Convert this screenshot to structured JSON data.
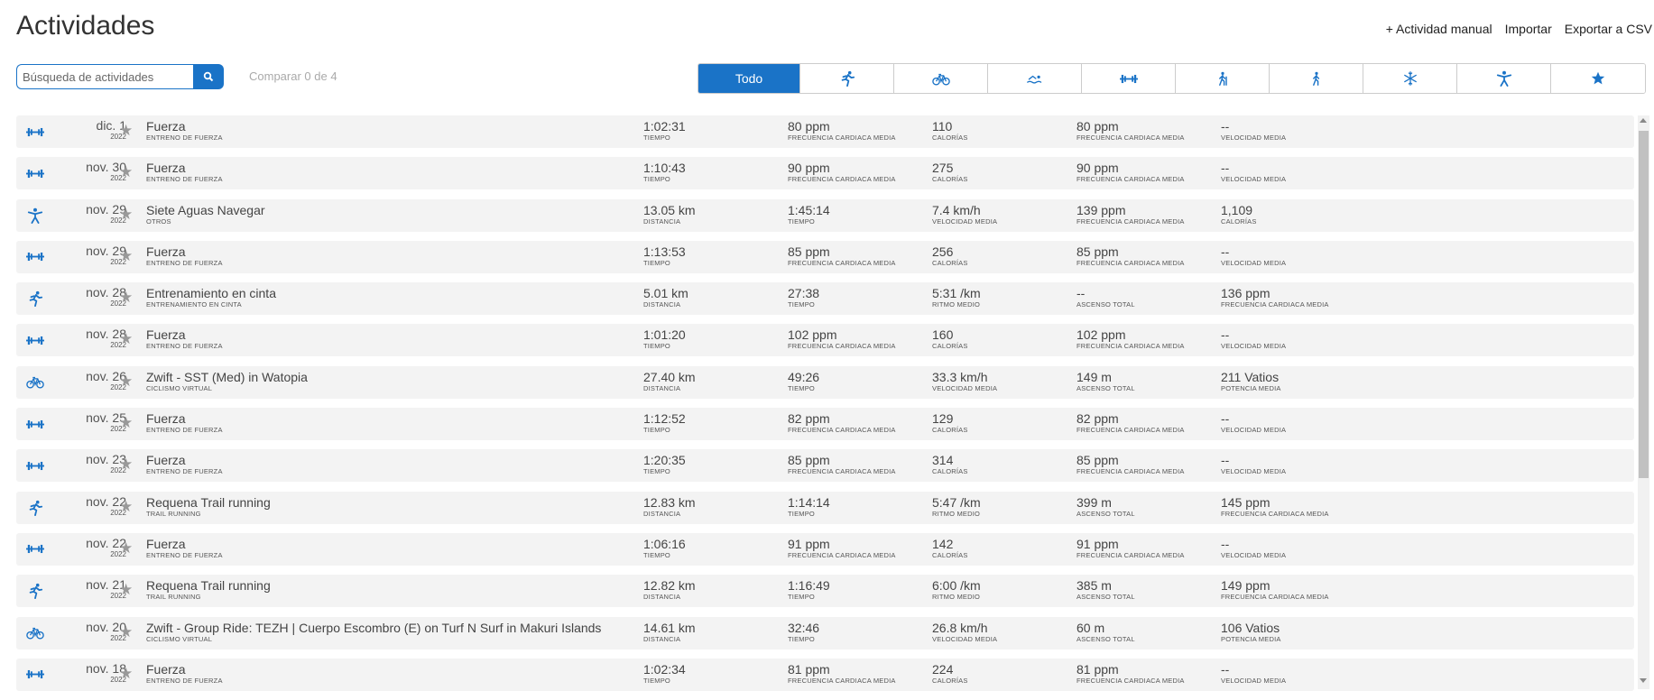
{
  "header": {
    "title": "Actividades",
    "links": [
      "+ Actividad manual",
      "Importar",
      "Exportar a CSV"
    ]
  },
  "search": {
    "placeholder": "Búsqueda de actividades"
  },
  "compare": "Comparar 0 de 4",
  "filters": [
    {
      "label": "Todo",
      "active": true
    },
    {
      "icon": "running"
    },
    {
      "icon": "cycling"
    },
    {
      "icon": "swimming"
    },
    {
      "icon": "strength"
    },
    {
      "icon": "hiking"
    },
    {
      "icon": "walking"
    },
    {
      "icon": "snowflake"
    },
    {
      "icon": "other"
    },
    {
      "icon": "star"
    }
  ],
  "activities": [
    {
      "icon": "strength",
      "date": "dic. 1",
      "year": "2022",
      "name": "Fuerza",
      "type": "ENTRENO DE FUERZA",
      "stats": [
        {
          "v": "1:02:31",
          "l": "TIEMPO"
        },
        {
          "v": "80 ppm",
          "l": "FRECUENCIA CARDIACA MEDIA"
        },
        {
          "v": "110",
          "l": "CALORÍAS"
        },
        {
          "v": "80 ppm",
          "l": "FRECUENCIA CARDIACA MEDIA"
        },
        {
          "v": "--",
          "l": "VELOCIDAD MEDIA"
        }
      ]
    },
    {
      "icon": "strength",
      "date": "nov. 30",
      "year": "2022",
      "name": "Fuerza",
      "type": "ENTRENO DE FUERZA",
      "stats": [
        {
          "v": "1:10:43",
          "l": "TIEMPO"
        },
        {
          "v": "90 ppm",
          "l": "FRECUENCIA CARDIACA MEDIA"
        },
        {
          "v": "275",
          "l": "CALORÍAS"
        },
        {
          "v": "90 ppm",
          "l": "FRECUENCIA CARDIACA MEDIA"
        },
        {
          "v": "--",
          "l": "VELOCIDAD MEDIA"
        }
      ]
    },
    {
      "icon": "other",
      "date": "nov. 29",
      "year": "2022",
      "name": "Siete Aguas Navegar",
      "type": "OTROS",
      "stats": [
        {
          "v": "13.05 km",
          "l": "DISTANCIA"
        },
        {
          "v": "1:45:14",
          "l": "TIEMPO"
        },
        {
          "v": "7.4 km/h",
          "l": "VELOCIDAD MEDIA"
        },
        {
          "v": "139 ppm",
          "l": "FRECUENCIA CARDIACA MEDIA"
        },
        {
          "v": "1,109",
          "l": "CALORÍAS"
        }
      ]
    },
    {
      "icon": "strength",
      "date": "nov. 29",
      "year": "2022",
      "name": "Fuerza",
      "type": "ENTRENO DE FUERZA",
      "stats": [
        {
          "v": "1:13:53",
          "l": "TIEMPO"
        },
        {
          "v": "85 ppm",
          "l": "FRECUENCIA CARDIACA MEDIA"
        },
        {
          "v": "256",
          "l": "CALORÍAS"
        },
        {
          "v": "85 ppm",
          "l": "FRECUENCIA CARDIACA MEDIA"
        },
        {
          "v": "--",
          "l": "VELOCIDAD MEDIA"
        }
      ]
    },
    {
      "icon": "running",
      "date": "nov. 28",
      "year": "2022",
      "name": "Entrenamiento en cinta",
      "type": "ENTRENAMIENTO EN CINTA",
      "stats": [
        {
          "v": "5.01 km",
          "l": "DISTANCIA"
        },
        {
          "v": "27:38",
          "l": "TIEMPO"
        },
        {
          "v": "5:31 /km",
          "l": "RITMO MEDIO"
        },
        {
          "v": "--",
          "l": "ASCENSO TOTAL"
        },
        {
          "v": "136 ppm",
          "l": "FRECUENCIA CARDIACA MEDIA"
        }
      ]
    },
    {
      "icon": "strength",
      "date": "nov. 28",
      "year": "2022",
      "name": "Fuerza",
      "type": "ENTRENO DE FUERZA",
      "stats": [
        {
          "v": "1:01:20",
          "l": "TIEMPO"
        },
        {
          "v": "102 ppm",
          "l": "FRECUENCIA CARDIACA MEDIA"
        },
        {
          "v": "160",
          "l": "CALORÍAS"
        },
        {
          "v": "102 ppm",
          "l": "FRECUENCIA CARDIACA MEDIA"
        },
        {
          "v": "--",
          "l": "VELOCIDAD MEDIA"
        }
      ]
    },
    {
      "icon": "cycling",
      "date": "nov. 26",
      "year": "2022",
      "name": "Zwift - SST (Med) in Watopia",
      "type": "CICLISMO VIRTUAL",
      "stats": [
        {
          "v": "27.40 km",
          "l": "DISTANCIA"
        },
        {
          "v": "49:26",
          "l": "TIEMPO"
        },
        {
          "v": "33.3 km/h",
          "l": "VELOCIDAD MEDIA"
        },
        {
          "v": "149 m",
          "l": "ASCENSO TOTAL"
        },
        {
          "v": "211 Vatios",
          "l": "POTENCIA MEDIA"
        }
      ]
    },
    {
      "icon": "strength",
      "date": "nov. 25",
      "year": "2022",
      "name": "Fuerza",
      "type": "ENTRENO DE FUERZA",
      "stats": [
        {
          "v": "1:12:52",
          "l": "TIEMPO"
        },
        {
          "v": "82 ppm",
          "l": "FRECUENCIA CARDIACA MEDIA"
        },
        {
          "v": "129",
          "l": "CALORÍAS"
        },
        {
          "v": "82 ppm",
          "l": "FRECUENCIA CARDIACA MEDIA"
        },
        {
          "v": "--",
          "l": "VELOCIDAD MEDIA"
        }
      ]
    },
    {
      "icon": "strength",
      "date": "nov. 23",
      "year": "2022",
      "name": "Fuerza",
      "type": "ENTRENO DE FUERZA",
      "stats": [
        {
          "v": "1:20:35",
          "l": "TIEMPO"
        },
        {
          "v": "85 ppm",
          "l": "FRECUENCIA CARDIACA MEDIA"
        },
        {
          "v": "314",
          "l": "CALORÍAS"
        },
        {
          "v": "85 ppm",
          "l": "FRECUENCIA CARDIACA MEDIA"
        },
        {
          "v": "--",
          "l": "VELOCIDAD MEDIA"
        }
      ]
    },
    {
      "icon": "running",
      "date": "nov. 22",
      "year": "2022",
      "name": "Requena Trail running",
      "type": "TRAIL RUNNING",
      "stats": [
        {
          "v": "12.83 km",
          "l": "DISTANCIA"
        },
        {
          "v": "1:14:14",
          "l": "TIEMPO"
        },
        {
          "v": "5:47 /km",
          "l": "RITMO MEDIO"
        },
        {
          "v": "399 m",
          "l": "ASCENSO TOTAL"
        },
        {
          "v": "145 ppm",
          "l": "FRECUENCIA CARDIACA MEDIA"
        }
      ]
    },
    {
      "icon": "strength",
      "date": "nov. 22",
      "year": "2022",
      "name": "Fuerza",
      "type": "ENTRENO DE FUERZA",
      "stats": [
        {
          "v": "1:06:16",
          "l": "TIEMPO"
        },
        {
          "v": "91 ppm",
          "l": "FRECUENCIA CARDIACA MEDIA"
        },
        {
          "v": "142",
          "l": "CALORÍAS"
        },
        {
          "v": "91 ppm",
          "l": "FRECUENCIA CARDIACA MEDIA"
        },
        {
          "v": "--",
          "l": "VELOCIDAD MEDIA"
        }
      ]
    },
    {
      "icon": "running",
      "date": "nov. 21",
      "year": "2022",
      "name": "Requena Trail running",
      "type": "TRAIL RUNNING",
      "stats": [
        {
          "v": "12.82 km",
          "l": "DISTANCIA"
        },
        {
          "v": "1:16:49",
          "l": "TIEMPO"
        },
        {
          "v": "6:00 /km",
          "l": "RITMO MEDIO"
        },
        {
          "v": "385 m",
          "l": "ASCENSO TOTAL"
        },
        {
          "v": "149 ppm",
          "l": "FRECUENCIA CARDIACA MEDIA"
        }
      ]
    },
    {
      "icon": "cycling",
      "date": "nov. 20",
      "year": "2022",
      "name": "Zwift - Group Ride: TEZH | Cuerpo Escombro (E) on Turf N Surf in Makuri Islands",
      "type": "CICLISMO VIRTUAL",
      "stats": [
        {
          "v": "14.61 km",
          "l": "DISTANCIA"
        },
        {
          "v": "32:46",
          "l": "TIEMPO"
        },
        {
          "v": "26.8 km/h",
          "l": "VELOCIDAD MEDIA"
        },
        {
          "v": "60 m",
          "l": "ASCENSO TOTAL"
        },
        {
          "v": "106 Vatios",
          "l": "POTENCIA MEDIA"
        }
      ]
    },
    {
      "icon": "strength",
      "date": "nov. 18",
      "year": "2022",
      "name": "Fuerza",
      "type": "ENTRENO DE FUERZA",
      "stats": [
        {
          "v": "1:02:34",
          "l": "TIEMPO"
        },
        {
          "v": "81 ppm",
          "l": "FRECUENCIA CARDIACA MEDIA"
        },
        {
          "v": "224",
          "l": "CALORÍAS"
        },
        {
          "v": "81 ppm",
          "l": "FRECUENCIA CARDIACA MEDIA"
        },
        {
          "v": "--",
          "l": "VELOCIDAD MEDIA"
        }
      ]
    }
  ],
  "colors": {
    "accent": "#1a73c7",
    "rowBg": "#f3f3f3"
  }
}
